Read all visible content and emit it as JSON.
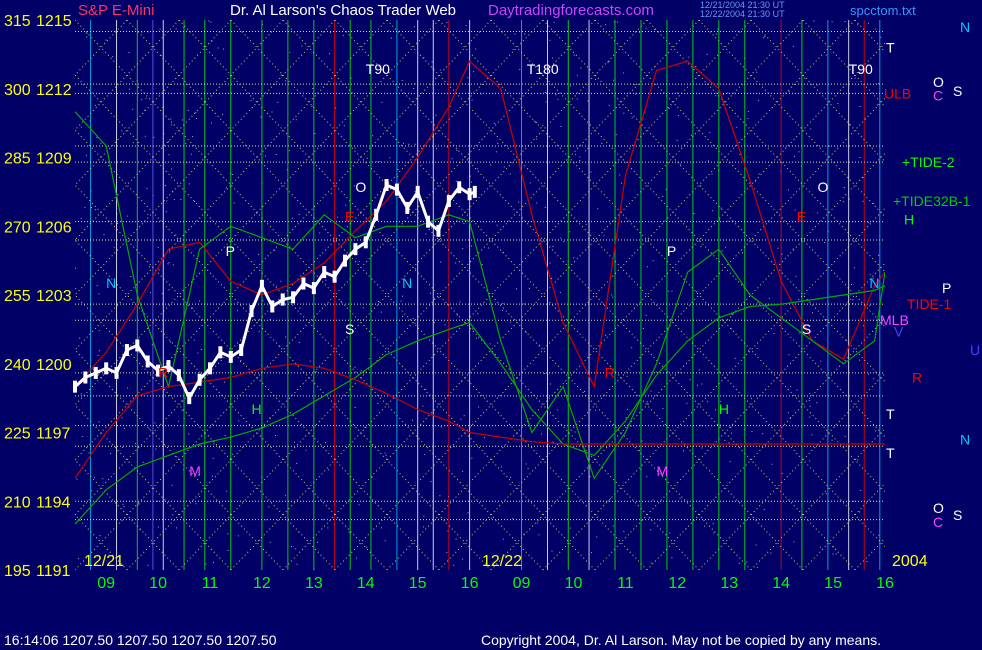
{
  "header": {
    "symbol": "S&P E-Mini",
    "title": "Dr. Al Larson's Chaos Trader Web",
    "site": "Daytradingforecasts.com",
    "stamp1": "12/21/2004 21:30 UT",
    "stamp2": "12/22/2004 21:30 UT",
    "file": "spcctom.txt"
  },
  "footer": {
    "status": "16:14:06   1207.50  1207.50  1207.50  1207.50",
    "copyright": "Copyright 2004, Dr. Al Larson. May not be copied by any means."
  },
  "colors": {
    "background": "#000066",
    "grid_dotted": "#cccc66",
    "price_bars": "#ffffff",
    "red_line": "#cc0000",
    "green_line": "#00aa00",
    "axis_left": "#ffff00",
    "hour_labels": "#00ff00"
  },
  "chart_data": {
    "type": "line",
    "title": "S&P E-Mini",
    "year_label": "2004",
    "date_labels": [
      "12/21",
      "12/22"
    ],
    "x_ticks": [
      "09",
      "10",
      "11",
      "12",
      "13",
      "14",
      "15",
      "16",
      "09",
      "10",
      "11",
      "12",
      "13",
      "14",
      "15",
      "16"
    ],
    "y_axis": [
      {
        "deg": "315",
        "price": "1215",
        "value": 1215
      },
      {
        "deg": "300",
        "price": "1212",
        "value": 1212
      },
      {
        "deg": "285",
        "price": "1209",
        "value": 1209
      },
      {
        "deg": "270",
        "price": "1206",
        "value": 1206
      },
      {
        "deg": "255",
        "price": "1203",
        "value": 1203
      },
      {
        "deg": "240",
        "price": "1200",
        "value": 1200
      },
      {
        "deg": "225",
        "price": "1197",
        "value": 1197
      },
      {
        "deg": "210",
        "price": "1194",
        "value": 1194
      },
      {
        "deg": "195",
        "price": "1191",
        "value": 1191
      }
    ],
    "ylim": [
      1191,
      1215
    ],
    "price_series": {
      "name": "S&P E-Mini",
      "x": [
        8.4,
        8.6,
        8.8,
        9.0,
        9.2,
        9.4,
        9.6,
        9.8,
        10.0,
        10.2,
        10.4,
        10.6,
        10.8,
        11.0,
        11.2,
        11.4,
        11.6,
        11.8,
        12.0,
        12.2,
        12.4,
        12.6,
        12.8,
        13.0,
        13.2,
        13.4,
        13.6,
        13.8,
        14.0,
        14.2,
        14.4,
        14.6,
        14.8,
        15.0,
        15.2,
        15.4,
        15.6,
        15.8,
        16.0,
        16.1
      ],
      "y": [
        1199.0,
        1199.4,
        1199.6,
        1199.8,
        1199.6,
        1200.6,
        1200.8,
        1200.1,
        1199.7,
        1199.9,
        1199.5,
        1198.5,
        1199.3,
        1199.8,
        1200.5,
        1200.3,
        1200.6,
        1202.3,
        1203.4,
        1202.5,
        1202.8,
        1202.9,
        1203.5,
        1203.3,
        1204.0,
        1203.8,
        1204.5,
        1205.0,
        1205.3,
        1206.5,
        1207.8,
        1207.6,
        1206.8,
        1207.5,
        1206.2,
        1205.8,
        1207.1,
        1207.7,
        1207.4,
        1207.5
      ]
    },
    "overlay_series": [
      {
        "name": "ULB",
        "color": "#cc0000",
        "x": [
          8.4,
          9.0,
          9.6,
          10.2,
          10.8,
          11.4,
          12.0,
          12.6,
          13.2,
          13.8,
          14.4,
          15.0,
          15.6,
          16.0,
          16.6,
          17.2,
          17.8,
          18.4,
          19.0,
          19.6,
          20.2,
          20.8,
          21.4,
          22.0,
          22.6,
          23.2,
          23.8,
          24.0
        ],
        "y": [
          1199.0,
          1200.5,
          1202.6,
          1205.0,
          1205.3,
          1203.6,
          1203.0,
          1203.5,
          1204.4,
          1205.8,
          1207.1,
          1209.0,
          1211.2,
          1213.2,
          1212.0,
          1206.5,
          1201.8,
          1199.0,
          1208.2,
          1212.8,
          1213.2,
          1212.0,
          1208.0,
          1203.6,
          1201.0,
          1200.2,
          1203.4,
          1204.0
        ]
      },
      {
        "name": "+TIDE-2",
        "color": "#00aa00",
        "x": [
          8.4,
          9.0,
          9.6,
          10.2,
          10.8,
          11.4,
          12.0,
          12.6,
          13.2,
          13.8,
          14.4,
          15.0,
          15.6,
          16.0,
          16.6,
          17.2,
          17.8,
          18.4,
          19.0,
          19.6,
          20.2,
          20.8,
          21.4,
          22.0,
          22.6,
          23.2,
          23.8,
          24.0
        ],
        "y": [
          1211.0,
          1209.5,
          1203.0,
          1199.0,
          1205.0,
          1206.0,
          1205.5,
          1205.0,
          1206.5,
          1205.5,
          1206.0,
          1206.0,
          1206.5,
          1206.2,
          1201.0,
          1197.0,
          1199.0,
          1195.0,
          1197.0,
          1200.0,
          1204.0,
          1205.0,
          1203.0,
          1202.0,
          1201.0,
          1200.0,
          1201.0,
          1204.0
        ]
      },
      {
        "name": "+TIDE32B-1",
        "color": "#00aa00",
        "x": [
          8.4,
          9.0,
          9.6,
          10.2,
          10.8,
          11.4,
          12.0,
          12.6,
          13.2,
          13.8,
          14.4,
          15.0,
          15.6,
          16.0,
          16.6,
          17.2,
          17.8,
          18.4,
          19.0,
          19.6,
          20.2,
          20.8,
          21.4,
          22.0,
          22.6,
          23.2,
          23.8,
          24.0
        ],
        "y": [
          1193.0,
          1194.5,
          1195.5,
          1196.0,
          1196.5,
          1196.8,
          1197.2,
          1197.8,
          1198.6,
          1199.4,
          1200.4,
          1201.0,
          1201.5,
          1201.8,
          1200.0,
          1198.0,
          1196.5,
          1196.0,
          1197.5,
          1199.5,
          1201.0,
          1202.0,
          1202.5,
          1202.6,
          1202.8,
          1203.0,
          1203.2,
          1203.4
        ]
      },
      {
        "name": "TIDE-1",
        "color": "#cc0000",
        "x": [
          8.4,
          9.0,
          9.6,
          10.2,
          10.8,
          11.4,
          12.0,
          12.6,
          13.2,
          13.8,
          14.4,
          15.0,
          15.6,
          16.0,
          16.6,
          17.2,
          17.8,
          18.4,
          19.0,
          19.6,
          20.2,
          20.8,
          21.4,
          22.0,
          22.6,
          23.2,
          23.8,
          24.0
        ],
        "y": [
          1195.0,
          1197.0,
          1198.6,
          1199.0,
          1199.2,
          1199.4,
          1199.8,
          1200.0,
          1199.8,
          1199.3,
          1198.7,
          1198.0,
          1197.5,
          1197.0,
          1196.8,
          1196.6,
          1196.5,
          1196.5,
          1196.5,
          1196.5,
          1196.5,
          1196.5,
          1196.5,
          1196.5,
          1196.5,
          1196.5,
          1196.5,
          1196.5
        ]
      }
    ],
    "right_labels": [
      {
        "text": "N",
        "color": "#00ccff",
        "value": 1214.7
      },
      {
        "text": "T",
        "color": "#ffffff",
        "value": 1213.8
      },
      {
        "text": "O",
        "color": "#ffffff",
        "value": 1212.3
      },
      {
        "text": "C",
        "color": "#ff44ff",
        "value": 1211.7
      },
      {
        "text": "S",
        "color": "#ffffff",
        "value": 1211.9
      },
      {
        "text": "ULB",
        "color": "#ff0000",
        "value": 1211.8
      },
      {
        "text": "+TIDE-2",
        "color": "#00ff00",
        "value": 1208.8
      },
      {
        "text": "+TIDE32B-1",
        "color": "#00cc00",
        "value": 1207.1
      },
      {
        "text": "H",
        "color": "#00ff00",
        "value": 1206.3
      },
      {
        "text": "P",
        "color": "#ffffff",
        "value": 1203.3
      },
      {
        "text": "TIDE-1",
        "color": "#ff0000",
        "value": 1202.6
      },
      {
        "text": "MLB",
        "color": "#ff44ff",
        "value": 1201.9
      },
      {
        "text": "V",
        "color": "#4444ff",
        "value": 1201.4
      },
      {
        "text": "U",
        "color": "#4444ff",
        "value": 1200.6
      },
      {
        "text": "R",
        "color": "#ff0000",
        "value": 1199.4
      },
      {
        "text": "T",
        "color": "#ffffff",
        "value": 1197.8
      },
      {
        "text": "T",
        "color": "#ffffff",
        "value": 1196.1
      },
      {
        "text": "N",
        "color": "#00ccff",
        "value": 1196.7
      },
      {
        "text": "O",
        "color": "#ffffff",
        "value": 1193.7
      },
      {
        "text": "C",
        "color": "#ff44ff",
        "value": 1193.1
      },
      {
        "text": "S",
        "color": "#ffffff",
        "value": 1193.4
      }
    ],
    "top_labels": [
      {
        "text": "T90",
        "x": 14.0
      },
      {
        "text": "T180",
        "x": 17.1
      },
      {
        "text": "T90",
        "x": 23.3
      }
    ],
    "in_chart_labels": [
      {
        "text": "N",
        "color": "#00ccff",
        "x": 9.0,
        "value": 1203.3
      },
      {
        "text": "P",
        "color": "#ffffff",
        "x": 11.3,
        "value": 1204.7
      },
      {
        "text": "O",
        "color": "#ffffff",
        "x": 13.8,
        "value": 1207.5
      },
      {
        "text": "N",
        "color": "#00ccff",
        "x": 14.7,
        "value": 1203.3
      },
      {
        "text": "S",
        "color": "#ffffff",
        "x": 13.6,
        "value": 1201.3
      },
      {
        "text": "H",
        "color": "#00ff00",
        "x": 11.8,
        "value": 1197.8
      },
      {
        "text": "M",
        "color": "#ff44ff",
        "x": 10.6,
        "value": 1195.1
      },
      {
        "text": "P",
        "color": "#ffffff",
        "x": 19.8,
        "value": 1204.7
      },
      {
        "text": "O",
        "color": "#ffffff",
        "x": 22.7,
        "value": 1207.5
      },
      {
        "text": "N",
        "color": "#00ccff",
        "x": 23.7,
        "value": 1203.3
      },
      {
        "text": "S",
        "color": "#ffffff",
        "x": 22.4,
        "value": 1201.3
      },
      {
        "text": "H",
        "color": "#00ff00",
        "x": 20.8,
        "value": 1197.8
      },
      {
        "text": "M",
        "color": "#ff44ff",
        "x": 19.6,
        "value": 1195.1
      },
      {
        "text": "R",
        "color": "#ff0000",
        "x": 10.0,
        "value": 1199.4
      },
      {
        "text": "R",
        "color": "#ff0000",
        "x": 18.6,
        "value": 1199.4
      },
      {
        "text": "E",
        "color": "#ff0000",
        "x": 13.6,
        "value": 1206.2
      },
      {
        "text": "E",
        "color": "#ff0000",
        "x": 22.3,
        "value": 1206.2
      }
    ],
    "vertical_lines": [
      {
        "x": 8.7,
        "color": "#00ccff"
      },
      {
        "x": 9.2,
        "color": "#ffffff"
      },
      {
        "x": 9.6,
        "color": "#00ff00"
      },
      {
        "x": 9.9,
        "color": "#6666ff"
      },
      {
        "x": 10.1,
        "color": "#ffffff"
      },
      {
        "x": 10.5,
        "color": "#00ff00"
      },
      {
        "x": 10.9,
        "color": "#00ff00"
      },
      {
        "x": 11.4,
        "color": "#00ff00"
      },
      {
        "x": 12.0,
        "color": "#00ff00"
      },
      {
        "x": 12.5,
        "color": "#00ff00"
      },
      {
        "x": 13.0,
        "color": "#00ff00"
      },
      {
        "x": 13.4,
        "color": "#ff0000"
      },
      {
        "x": 13.7,
        "color": "#00ff00"
      },
      {
        "x": 14.1,
        "color": "#00ff00"
      },
      {
        "x": 14.6,
        "color": "#00ccff"
      },
      {
        "x": 15.0,
        "color": "#ffffff"
      },
      {
        "x": 15.3,
        "color": "#ffffff"
      },
      {
        "x": 15.6,
        "color": "#ff0000"
      },
      {
        "x": 16.0,
        "color": "#ffffff"
      },
      {
        "x": 17.0,
        "color": "#00ccff"
      },
      {
        "x": 17.5,
        "color": "#ffffff"
      },
      {
        "x": 17.9,
        "color": "#00ff00"
      },
      {
        "x": 18.3,
        "color": "#ffffff"
      },
      {
        "x": 18.8,
        "color": "#00ff00"
      },
      {
        "x": 19.3,
        "color": "#00ff00"
      },
      {
        "x": 19.8,
        "color": "#00ff00"
      },
      {
        "x": 20.3,
        "color": "#00ff00"
      },
      {
        "x": 20.8,
        "color": "#00ff00"
      },
      {
        "x": 21.3,
        "color": "#00ff00"
      },
      {
        "x": 22.0,
        "color": "#ff0000"
      },
      {
        "x": 22.4,
        "color": "#00ff00"
      },
      {
        "x": 22.9,
        "color": "#00ccff"
      },
      {
        "x": 23.3,
        "color": "#ffffff"
      },
      {
        "x": 23.6,
        "color": "#ff0000"
      },
      {
        "x": 23.9,
        "color": "#00ccff"
      }
    ],
    "horizontal_lines": [
      1214.5,
      1212.2,
      1211.8,
      1209.5,
      1208.8,
      1206.2,
      1205.4,
      1202.6,
      1201.9,
      1199.6,
      1198.6,
      1197.3,
      1196.4,
      1194.0,
      1193.2
    ]
  }
}
